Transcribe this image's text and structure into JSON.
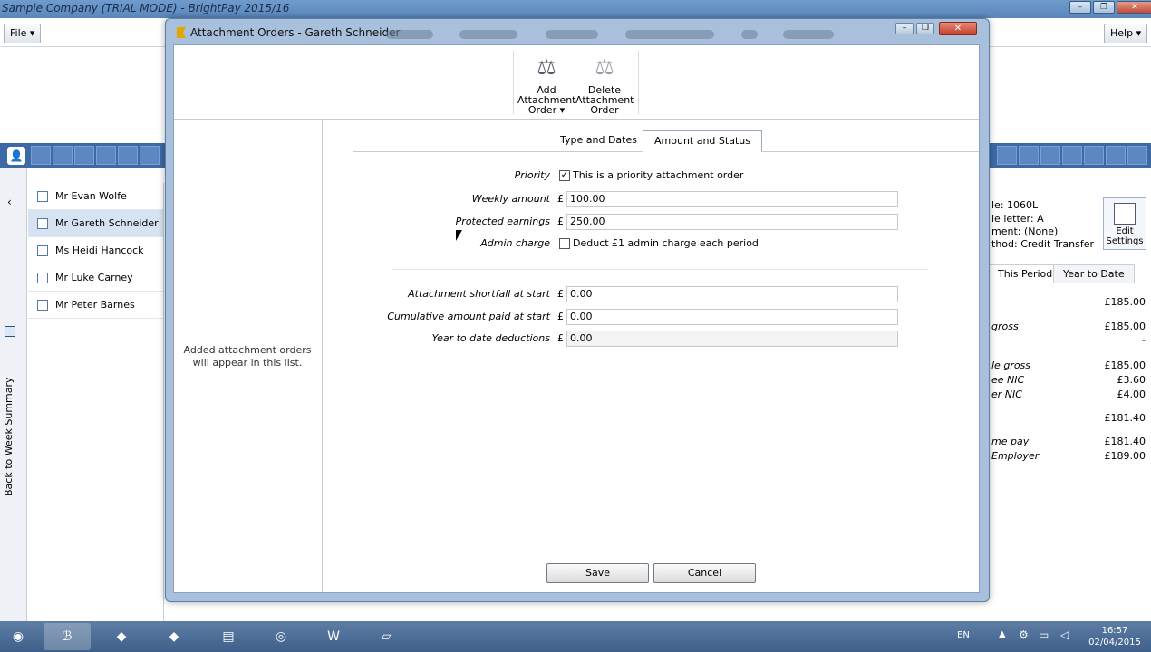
{
  "main_window": {
    "title": "Sample Company (TRIAL MODE) - BrightPay 2015/16",
    "menu_file": "File ▾",
    "menu_help": "Help ▾",
    "back_to_week_summary": "Back to Week Summary",
    "employees": [
      "Mr Evan Wolfe",
      "Mr Gareth Schneider",
      "Ms Heidi Hancock",
      "Mr Luke Carney",
      "Mr Peter Barnes"
    ],
    "right_panel": {
      "tax_code": "le: 1060L",
      "table_letter": "le letter: A",
      "payment": "ment: (None)",
      "method": "thod: Credit Transfer",
      "edit_settings": "Edit Settings",
      "tab_this_period": "This Period",
      "tab_year_to_date": "Year to Date",
      "rows": [
        {
          "label": "",
          "value": "£185.00"
        },
        {
          "label": "gross",
          "value": "£185.00"
        },
        {
          "label": "",
          "value": "-"
        },
        {
          "label": "le gross",
          "value": "£185.00"
        },
        {
          "label": "ee NIC",
          "value": "£3.60"
        },
        {
          "label": "er NIC",
          "value": "£4.00"
        },
        {
          "label": "",
          "value": "£181.40"
        },
        {
          "label": "me pay",
          "value": "£181.40"
        },
        {
          "label": "Employer",
          "value": "£189.00"
        }
      ]
    }
  },
  "dialog": {
    "title": "Attachment Orders - Gareth Schneider",
    "toolbar": {
      "add": "Add Attachment Order ▾",
      "delete": "Delete Attachment Order"
    },
    "empty_list_message": "Added attachment orders will appear in this list.",
    "tabs": [
      "Type and Dates",
      "Amount and Status"
    ],
    "active_tab": "Amount and Status",
    "fields": {
      "priority_label": "Priority",
      "priority_text": "This is a priority attachment order",
      "priority_checked": true,
      "weekly_amount_label": "Weekly amount",
      "weekly_amount": "100.00",
      "protected_earnings_label": "Protected earnings",
      "protected_earnings": "250.00",
      "admin_charge_label": "Admin charge",
      "admin_charge_text": "Deduct £1 admin charge each period",
      "admin_charge_checked": false,
      "shortfall_label": "Attachment shortfall at start",
      "shortfall": "0.00",
      "cumulative_label": "Cumulative amount paid at start",
      "cumulative": "0.00",
      "ytd_label": "Year to date deductions",
      "ytd": "0.00",
      "currency": "£"
    },
    "save": "Save",
    "cancel": "Cancel"
  },
  "taskbar": {
    "lang": "EN",
    "time": "16:57",
    "date": "02/04/2015"
  }
}
